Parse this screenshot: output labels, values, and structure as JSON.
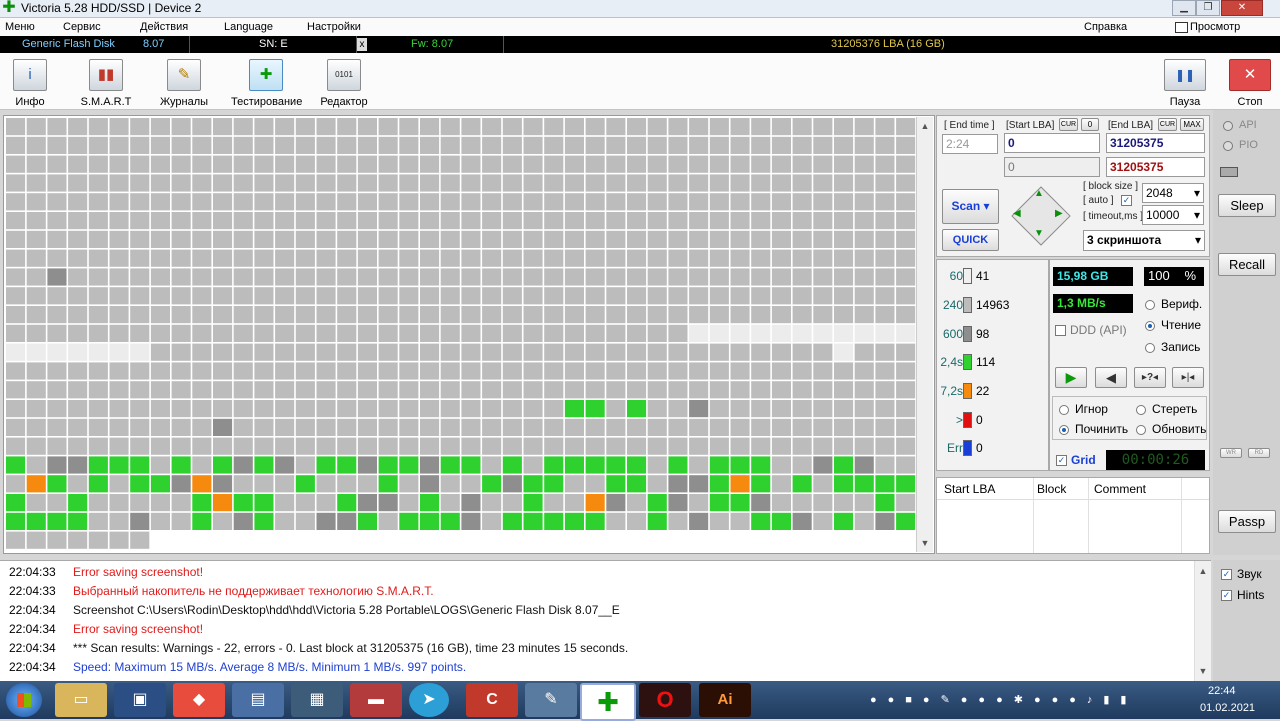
{
  "window": {
    "title": "Victoria 5.28 HDD/SSD | Device 2",
    "minimize": "▁",
    "maximize": "❐",
    "close": "✕"
  },
  "menu": {
    "items": [
      "Меню",
      "Сервис",
      "Действия",
      "Language",
      "Настройки"
    ],
    "help": "Справка",
    "clipboard": "Просмотр буфера"
  },
  "device": {
    "name": "Generic Flash Disk",
    "rev": "8.07",
    "sn": "SN: E",
    "x": "x",
    "fw": "Fw: 8.07",
    "capacity": "31205376 LBA (16 GB)"
  },
  "toolbar": {
    "buttons": [
      {
        "label": "Инфо",
        "icon": "info-icon",
        "glyph": "i"
      },
      {
        "label": "S.M.A.R.T",
        "icon": "smart-icon",
        "glyph": "▮▮"
      },
      {
        "label": "Журналы",
        "icon": "logs-icon",
        "glyph": "✎"
      },
      {
        "label": "Тестирование",
        "icon": "test-icon",
        "glyph": "✚"
      },
      {
        "label": "Редактор",
        "icon": "editor-icon",
        "glyph": "0101"
      }
    ],
    "pause_label": "Пауза",
    "stop_label": "Стоп",
    "pause_glyph": "❚❚",
    "stop_glyph": "✕"
  },
  "scan": {
    "end_time_label": "[ End time ]",
    "end_time": "2:24",
    "start_lba_label": "[Start LBA]",
    "start_lba": "0",
    "start_lba_2": "0",
    "end_lba_label": "[End LBA]",
    "end_lba": "31205375",
    "end_lba_2": "31205375",
    "cur_label": "CUR",
    "zero_label": "0",
    "max_label": "MAX",
    "scan_btn": "Scan",
    "quick_btn": "QUICK",
    "block_size_label": "[ block size ]",
    "auto_label": "[ auto ]",
    "timeout_label": "[ timeout,ms ]",
    "block_size": "2048",
    "timeout": "10000",
    "screenshots": "3 скриншота"
  },
  "legend": [
    {
      "ms": "60",
      "count": "41",
      "color": "#f0f0f0"
    },
    {
      "ms": "240",
      "count": "14963",
      "color": "#bcbcbc"
    },
    {
      "ms": "600",
      "count": "98",
      "color": "#8e8e8e"
    },
    {
      "ms": "2,4s",
      "count": "114",
      "color": "#2ed12e"
    },
    {
      "ms": "7,2s",
      "count": "22",
      "color": "#f58a0f"
    },
    {
      "ms": ">",
      "count": "0",
      "color": "#e01010"
    },
    {
      "ms": "Err",
      "count": "0",
      "color": "#1a3fd6"
    }
  ],
  "stats": {
    "size": "15,98 GB",
    "percent": "100",
    "percent_sign": "%",
    "speed": "1,3 MB/s",
    "ddd": "DDD (API)"
  },
  "modes": {
    "verify": "Вериф.",
    "read": "Чтение",
    "write": "Запись"
  },
  "actions": {
    "ignore": "Игнор",
    "erase": "Стереть",
    "repair": "Починить",
    "refresh": "Обновить"
  },
  "grid_label": "Grid",
  "timer": "00:00:26",
  "table": {
    "headers": [
      "Start LBA",
      "Block",
      "Comment"
    ]
  },
  "side": {
    "api": "API",
    "pio": "PIO",
    "sleep": "Sleep",
    "recall": "Recall",
    "passp": "Passp",
    "sound": "Звук",
    "hints": "Hints",
    "wr": "WR",
    "rd": "RD"
  },
  "log": [
    {
      "time": "22:04:33",
      "text": "Error saving screenshot!",
      "color": "#e01b1b"
    },
    {
      "time": "22:04:33",
      "text": "Выбранный накопитель не поддерживает технологию S.M.A.R.T.",
      "color": "#e01b1b"
    },
    {
      "time": "22:04:34",
      "text": "Screenshot C:\\Users\\Rodin\\Desktop\\hdd\\hdd\\Victoria 5.28 Portable\\LOGS\\Generic Flash Disk      8.07__E",
      "color": "#111111"
    },
    {
      "time": "22:04:34",
      "text": "Error saving screenshot!",
      "color": "#e01b1b"
    },
    {
      "time": "22:04:34",
      "text": "*** Scan results: Warnings - 22, errors - 0. Last block at 31205375 (16 GB), time 23 minutes 15 seconds.",
      "color": "#111111"
    },
    {
      "time": "22:04:34",
      "text": "Speed: Maximum 15 MB/s. Average 8 MB/s. Minimum 1 MB/s. 997 points.",
      "color": "#1f3fd0"
    }
  ],
  "taskbar": {
    "time": "22:44",
    "date": "01.02.2021",
    "apps": [
      "windows-start",
      "explorer",
      "disk-utility",
      "anydesk",
      "remote-desktop",
      "terminal",
      "toolbox",
      "telegram",
      "ccleaner",
      "tools",
      "victoria",
      "opera",
      "illustrator"
    ],
    "illustrator_label": "Ai"
  },
  "colors": {
    "accent_blue": "#1a3fd6",
    "ok": "#2ed12e",
    "warn": "#f58a0f"
  }
}
